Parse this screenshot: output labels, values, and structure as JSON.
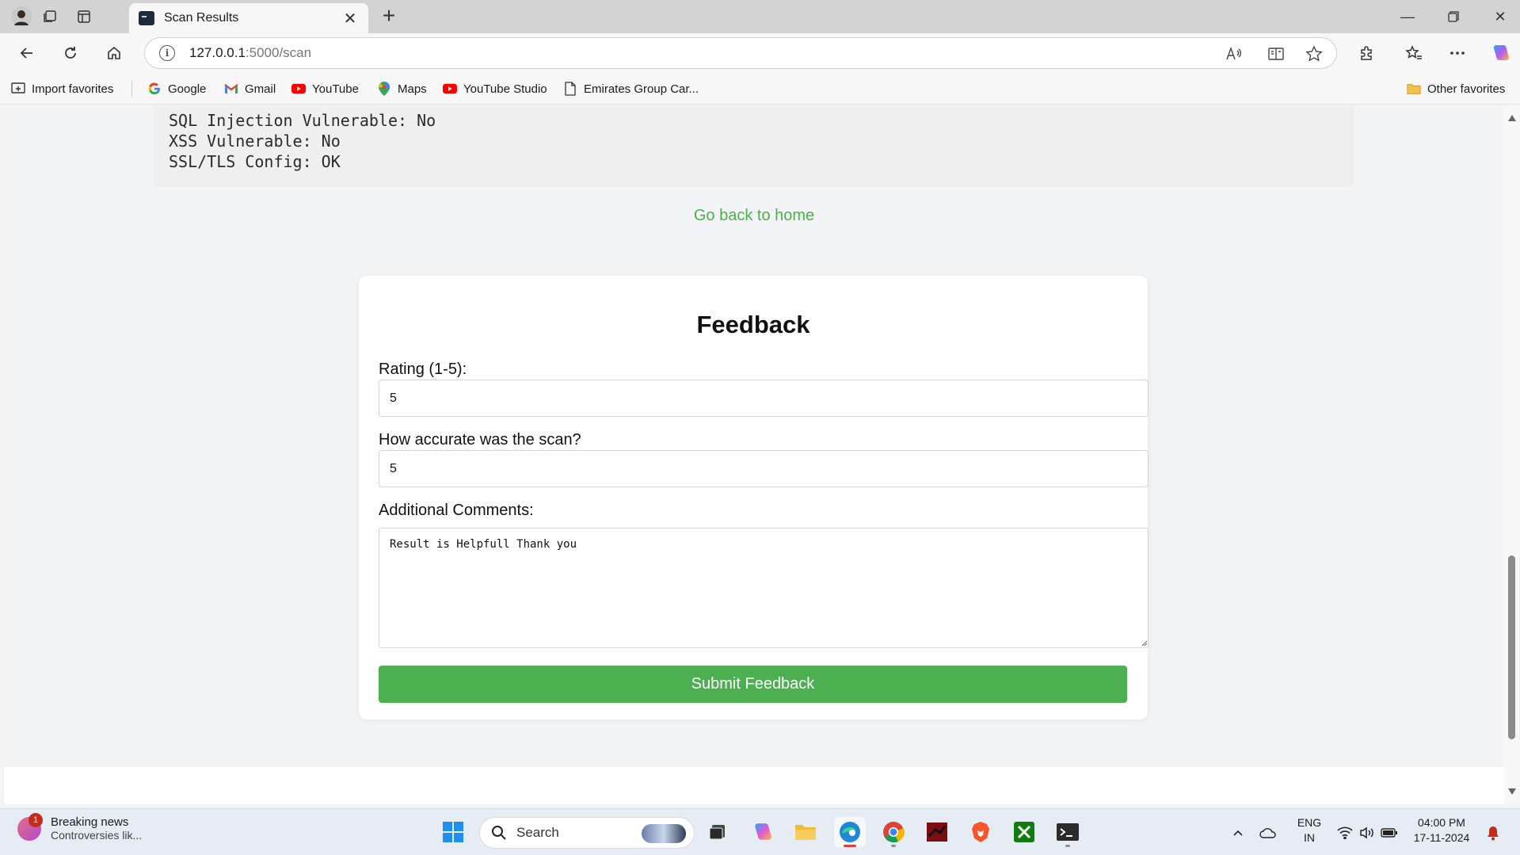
{
  "browser": {
    "tab_title": "Scan Results",
    "url_host": "127.0.0.1",
    "url_path": ":5000/scan"
  },
  "favorites": [
    {
      "label": "Import favorites",
      "icon": "import-icon"
    },
    {
      "label": "Google",
      "icon": "google-icon"
    },
    {
      "label": "Gmail",
      "icon": "gmail-icon"
    },
    {
      "label": "YouTube",
      "icon": "youtube-icon"
    },
    {
      "label": "Maps",
      "icon": "maps-icon"
    },
    {
      "label": "YouTube Studio",
      "icon": "youtube-studio-icon"
    },
    {
      "label": "Emirates Group Car...",
      "icon": "document-icon"
    },
    {
      "label": "Other favorites",
      "icon": "folder-icon"
    }
  ],
  "results": {
    "lines": [
      "SQL Injection Vulnerable: No",
      "XSS Vulnerable: No",
      "SSL/TLS Config: OK"
    ]
  },
  "back_link": "Go back to home",
  "feedback": {
    "title": "Feedback",
    "rating_label": "Rating (1-5):",
    "rating_value": "5",
    "accuracy_label": "How accurate was the scan?",
    "accuracy_value": "5",
    "comments_label": "Additional Comments:",
    "comments_value": "Result is Helpfull Thank you",
    "submit_label": "Submit Feedback"
  },
  "taskbar": {
    "news_badge": "1",
    "news_title": "Breaking news",
    "news_sub": "Controversies lik...",
    "search_label": "Search",
    "lang_top": "ENG",
    "lang_bottom": "IN",
    "time": "04:00 PM",
    "date": "17-11-2024"
  },
  "colors": {
    "accent_green": "#4caf50",
    "page_bg": "#f3f4f6"
  }
}
